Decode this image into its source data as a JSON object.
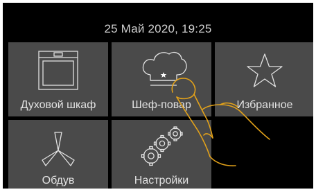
{
  "header": {
    "datetime": "25 Май 2020, 19:25"
  },
  "tiles": [
    {
      "label": "Духовой шкаф",
      "icon": "oven-icon"
    },
    {
      "label": "Шеф-повар",
      "icon": "chef-hat-icon"
    },
    {
      "label": "Избранное",
      "icon": "star-icon"
    },
    {
      "label": "Обдув",
      "icon": "fan-icon"
    },
    {
      "label": "Настройки",
      "icon": "gears-icon"
    }
  ],
  "colors": {
    "screen_bg": "#000000",
    "tile_bg": "#4a4a4a",
    "text": "#e2e2e2",
    "hand_stroke": "#e3a21a"
  }
}
